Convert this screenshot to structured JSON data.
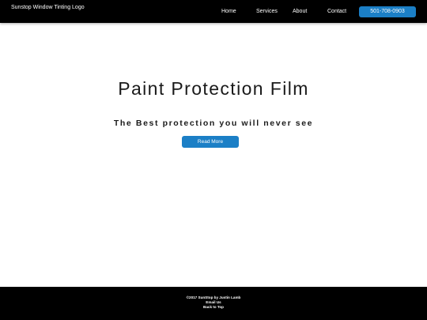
{
  "header": {
    "logo_alt": "Sunstop Window Tinting Logo",
    "nav": {
      "home": "Home",
      "services": "Services",
      "about": "About",
      "contact": "Contact"
    },
    "phone": "501-708-0903"
  },
  "hero": {
    "title": "Paint Protection Film",
    "subtitle": "The Best protection you will never see",
    "button_label": "Read More"
  },
  "footer": {
    "copyright": "©2017 SunStop by Justin Lamb",
    "email_link": "Email Us",
    "top_link": "Back to Top"
  },
  "colors": {
    "header_bg": "#000000",
    "accent": "#1b7fc6",
    "page_bg": "#ffffff",
    "footer_bg": "#000000"
  }
}
